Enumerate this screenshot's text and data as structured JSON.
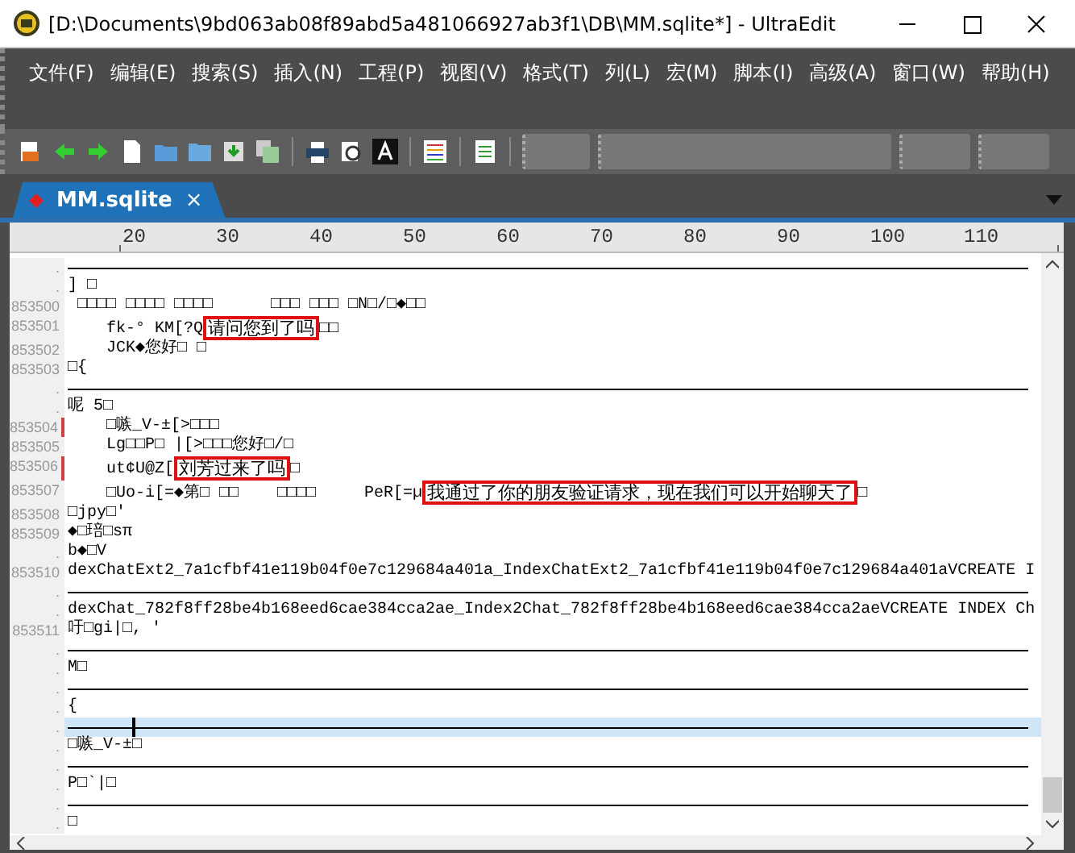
{
  "window": {
    "title": "[D:\\Documents\\9bd063ab08f89abd5a481066927ab3f1\\DB\\MM.sqlite*] - UltraEdit"
  },
  "menu": [
    "文件(F)",
    "编辑(E)",
    "搜索(S)",
    "插入(N)",
    "工程(P)",
    "视图(V)",
    "格式(T)",
    "列(L)",
    "宏(M)",
    "脚本(I)",
    "高级(A)",
    "窗口(W)",
    "帮助(H)"
  ],
  "tabs": [
    {
      "label": "MM.sqlite",
      "close": "×",
      "selected": true
    }
  ],
  "ruler": [
    "20",
    "30",
    "40",
    "50",
    "60",
    "70",
    "80",
    "90",
    "100",
    "110"
  ],
  "rows": [
    {
      "kind": "rule",
      "gutter": ".",
      "current": false
    },
    {
      "kind": "text",
      "gutter": ".",
      "marked": false,
      "current": false,
      "segments": [
        {
          "text": "] □",
          "boxed": false
        }
      ]
    },
    {
      "kind": "text",
      "gutter": "853500",
      "marked": false,
      "current": false,
      "segments": [
        {
          "text": " □□□□ □□□□ □□□□      □□□ □□□ □N□/□◆□□",
          "boxed": false
        }
      ]
    },
    {
      "kind": "text",
      "gutter": "853501",
      "marked": false,
      "current": false,
      "segments": [
        {
          "text": "    fk-° KM[?Q",
          "boxed": false
        },
        {
          "text": "请问您到了吗",
          "boxed": true
        },
        {
          "text": "□□",
          "boxed": false
        }
      ]
    },
    {
      "kind": "text",
      "gutter": "853502",
      "marked": false,
      "current": false,
      "segments": [
        {
          "text": "    JCK◆您好□ □",
          "boxed": false
        }
      ]
    },
    {
      "kind": "text",
      "gutter": "853503",
      "marked": false,
      "current": false,
      "segments": [
        {
          "text": "□{",
          "boxed": false
        }
      ]
    },
    {
      "kind": "rule",
      "gutter": ".",
      "current": false
    },
    {
      "kind": "text",
      "gutter": ".",
      "marked": false,
      "current": false,
      "segments": [
        {
          "text": "呢 5□",
          "boxed": false
        }
      ]
    },
    {
      "kind": "text",
      "gutter": "853504",
      "marked": true,
      "current": false,
      "segments": [
        {
          "text": "    □嗾_V-±[>□□□",
          "boxed": false
        }
      ]
    },
    {
      "kind": "text",
      "gutter": "853505",
      "marked": false,
      "current": false,
      "segments": [
        {
          "text": "    Lg□□P□ |[>□□□您好□/□",
          "boxed": false
        }
      ]
    },
    {
      "kind": "text",
      "gutter": "853506",
      "marked": true,
      "current": false,
      "segments": [
        {
          "text": "    ut¢U@Z[",
          "boxed": false
        },
        {
          "text": "刘芳过来了吗",
          "boxed": true
        },
        {
          "text": "□",
          "boxed": false
        }
      ]
    },
    {
      "kind": "text",
      "gutter": "853507",
      "marked": false,
      "current": false,
      "segments": [
        {
          "text": "    □Uo-i[=◆第□ □□    □□□□     PeR[=µ",
          "boxed": false
        },
        {
          "text": "我通过了你的朋友验证请求，现在我们可以开始聊天了",
          "boxed": true
        },
        {
          "text": "□",
          "boxed": false
        }
      ]
    },
    {
      "kind": "text",
      "gutter": "853508",
      "marked": false,
      "current": false,
      "segments": [
        {
          "text": "□jpy□'",
          "boxed": false
        }
      ]
    },
    {
      "kind": "text",
      "gutter": "853509",
      "marked": false,
      "current": false,
      "segments": [
        {
          "text": "◆□琣□sπ",
          "boxed": false
        }
      ]
    },
    {
      "kind": "text",
      "gutter": ".",
      "marked": false,
      "current": false,
      "segments": [
        {
          "text": "b◆□V",
          "boxed": false
        }
      ]
    },
    {
      "kind": "text",
      "gutter": "853510",
      "marked": false,
      "current": false,
      "segments": [
        {
          "text": "dexChatExt2_7a1cfbf41e119b04f0e7c129684a401a_IndexChatExt2_7a1cfbf41e119b04f0e7c129684a401aVCREATE I",
          "boxed": false
        }
      ]
    },
    {
      "kind": "rule",
      "gutter": ".",
      "current": false
    },
    {
      "kind": "text",
      "gutter": ".",
      "marked": false,
      "current": false,
      "segments": [
        {
          "text": "dexChat_782f8ff28be4b168eed6cae384cca2ae_Index2Chat_782f8ff28be4b168eed6cae384cca2aeVCREATE INDEX Ch",
          "boxed": false
        }
      ]
    },
    {
      "kind": "text",
      "gutter": "853511",
      "marked": false,
      "current": false,
      "segments": [
        {
          "text": "吁□gi|□, '",
          "boxed": false
        }
      ]
    },
    {
      "kind": "rule",
      "gutter": ".",
      "current": false
    },
    {
      "kind": "text",
      "gutter": ".",
      "marked": false,
      "current": false,
      "segments": [
        {
          "text": "M□",
          "boxed": false
        }
      ]
    },
    {
      "kind": "rule",
      "gutter": ".",
      "current": false
    },
    {
      "kind": "text",
      "gutter": ".",
      "marked": false,
      "current": false,
      "segments": [
        {
          "text": "{",
          "boxed": false
        }
      ]
    },
    {
      "kind": "rule",
      "gutter": ".",
      "current": true
    },
    {
      "kind": "text",
      "gutter": ".",
      "marked": false,
      "current": false,
      "segments": [
        {
          "text": "□嗾_V-±□",
          "boxed": false
        }
      ]
    },
    {
      "kind": "rule",
      "gutter": ".",
      "current": false
    },
    {
      "kind": "text",
      "gutter": ".",
      "marked": false,
      "current": false,
      "segments": [
        {
          "text": "P□`|□",
          "boxed": false
        }
      ]
    },
    {
      "kind": "rule",
      "gutter": ".",
      "current": false
    },
    {
      "kind": "text",
      "gutter": ".",
      "marked": false,
      "current": false,
      "segments": [
        {
          "text": "□",
          "boxed": false
        }
      ]
    }
  ]
}
